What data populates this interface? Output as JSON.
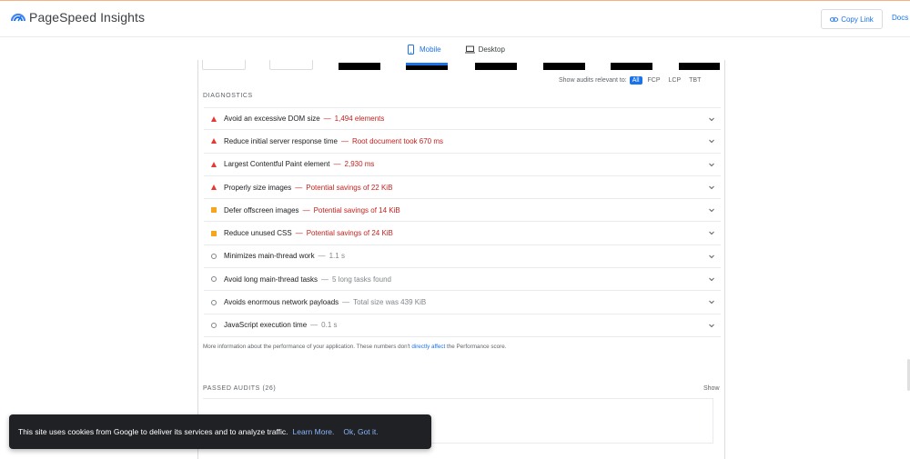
{
  "header": {
    "app_title": "PageSpeed Insights",
    "copy_link_label": "Copy Link",
    "docs_label": "Docs"
  },
  "tabs": [
    {
      "label": "Mobile",
      "active": true
    },
    {
      "label": "Desktop",
      "active": false
    }
  ],
  "filter": {
    "label": "Show audits relevant to:",
    "chips": [
      "All",
      "FCP",
      "LCP",
      "TBT"
    ],
    "active": "All"
  },
  "diagnostics": {
    "title": "DIAGNOSTICS",
    "audits": [
      {
        "severity": "fail",
        "title": "Avoid an excessive DOM size",
        "detail": "1,494 elements"
      },
      {
        "severity": "fail",
        "title": "Reduce initial server response time",
        "detail": "Root document took 670 ms"
      },
      {
        "severity": "fail",
        "title": "Largest Contentful Paint element",
        "detail": "2,930 ms"
      },
      {
        "severity": "fail",
        "title": "Properly size images",
        "detail": "Potential savings of 22 KiB"
      },
      {
        "severity": "average",
        "title": "Defer offscreen images",
        "detail": "Potential savings of 14 KiB"
      },
      {
        "severity": "average",
        "title": "Reduce unused CSS",
        "detail": "Potential savings of 24 KiB"
      },
      {
        "severity": "info",
        "title": "Minimizes main-thread work",
        "detail": "1.1 s"
      },
      {
        "severity": "info",
        "title": "Avoid long main-thread tasks",
        "detail": "5 long tasks found"
      },
      {
        "severity": "info",
        "title": "Avoids enormous network payloads",
        "detail": "Total size was 439 KiB"
      },
      {
        "severity": "info",
        "title": "JavaScript execution time",
        "detail": "0.1 s"
      }
    ],
    "info_prefix": "More information about the performance of your application. These numbers don't",
    "info_link": "directly affect",
    "info_suffix": "the Performance score."
  },
  "passed": {
    "title": "PASSED AUDITS (26)",
    "show_label": "Show"
  },
  "cookie_toast": {
    "message": "This site uses cookies from Google to deliver its services and to analyze traffic.",
    "learn_more": "Learn More.",
    "ok": "Ok, Got it."
  },
  "colors": {
    "accent": "#1a73e8",
    "fail": "#e53935",
    "average": "#f4a621",
    "fail_text": "#c5221f"
  }
}
